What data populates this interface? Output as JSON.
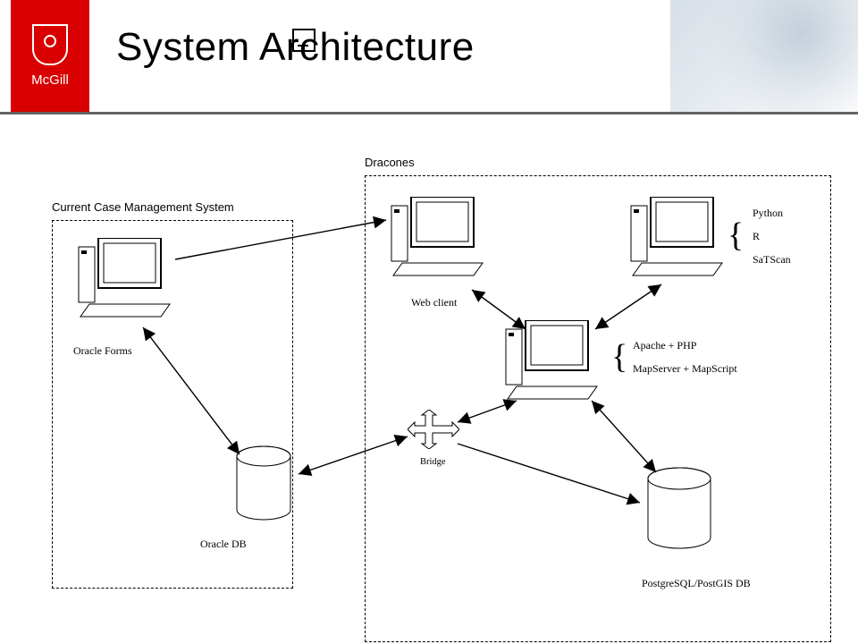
{
  "header": {
    "org": "McGill",
    "title": "System Architecture"
  },
  "groups": {
    "left": {
      "label": "Current Case Management System"
    },
    "right": {
      "label": "Dracones"
    }
  },
  "nodes": {
    "oracle_forms": {
      "label": "Oracle Forms"
    },
    "oracle_db": {
      "label": "Oracle DB"
    },
    "web_client": {
      "label": "Web client"
    },
    "analytics": {
      "lines": [
        "Python",
        "R",
        "SaTScan"
      ]
    },
    "app_server": {
      "lines": [
        "Apache + PHP",
        "MapServer + MapScript"
      ]
    },
    "bridge": {
      "label": "Bridge"
    },
    "pg_db": {
      "label": "PostgreSQL/PostGIS DB"
    }
  },
  "arrows": [
    {
      "from": "oracle_forms",
      "to": "oracle_db",
      "bidir": true
    },
    {
      "from": "oracle_forms",
      "to": "web_client",
      "bidir": false
    },
    {
      "from": "web_client",
      "to": "app_server",
      "bidir": true
    },
    {
      "from": "analytics",
      "to": "app_server",
      "bidir": true
    },
    {
      "from": "app_server",
      "to": "pg_db",
      "bidir": true
    },
    {
      "from": "app_server",
      "to": "bridge",
      "bidir": true
    },
    {
      "from": "bridge",
      "to": "oracle_db",
      "bidir": true
    },
    {
      "from": "bridge",
      "to": "pg_db",
      "bidir": false
    }
  ]
}
